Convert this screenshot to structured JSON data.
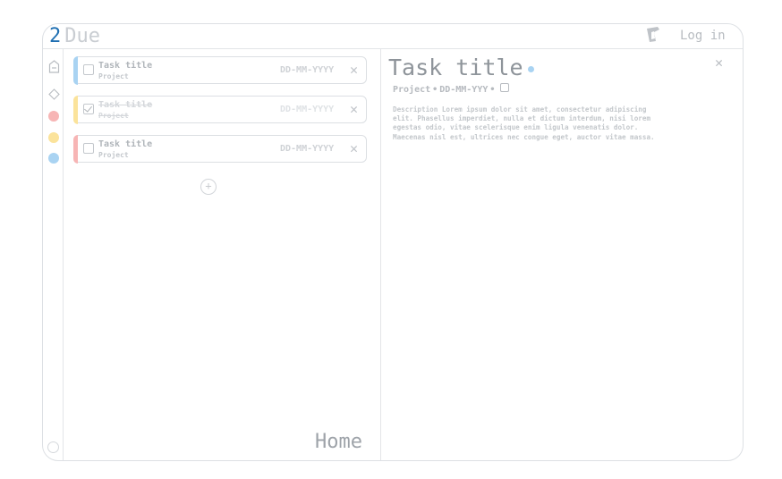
{
  "header": {
    "logo_number": "2",
    "logo_word": "Due",
    "login_label": "Log in"
  },
  "sidebar": {
    "icons": [
      "tag-icon",
      "diamond-icon"
    ],
    "color_filters": [
      "#f7b5b5",
      "#fbe39b",
      "#a9d3f2"
    ]
  },
  "tasks": [
    {
      "title": "Task title",
      "project": "Project",
      "date": "DD-MM-YYYY",
      "done": false,
      "color": "#a9d3f2"
    },
    {
      "title": "Task title",
      "project": "Project",
      "date": "DD-MM-YYYY",
      "done": true,
      "color": "#fbe39b"
    },
    {
      "title": "Task title",
      "project": "Project",
      "date": "DD-MM-YYYY",
      "done": false,
      "color": "#f7b5b5"
    }
  ],
  "list": {
    "home_label": "Home"
  },
  "detail": {
    "title": "Task title",
    "project": "Project",
    "date": "DD-MM-YYY",
    "description": "Description Lorem ipsum dolor sit amet, consectetur adipiscing elit. Phasellus imperdiet, nulla et dictum interdum, nisi lorem egestas odio, vitae scelerisque enim ligula venenatis dolor. Maecenas nisl est, ultrices nec congue eget, auctor vitae massa."
  }
}
